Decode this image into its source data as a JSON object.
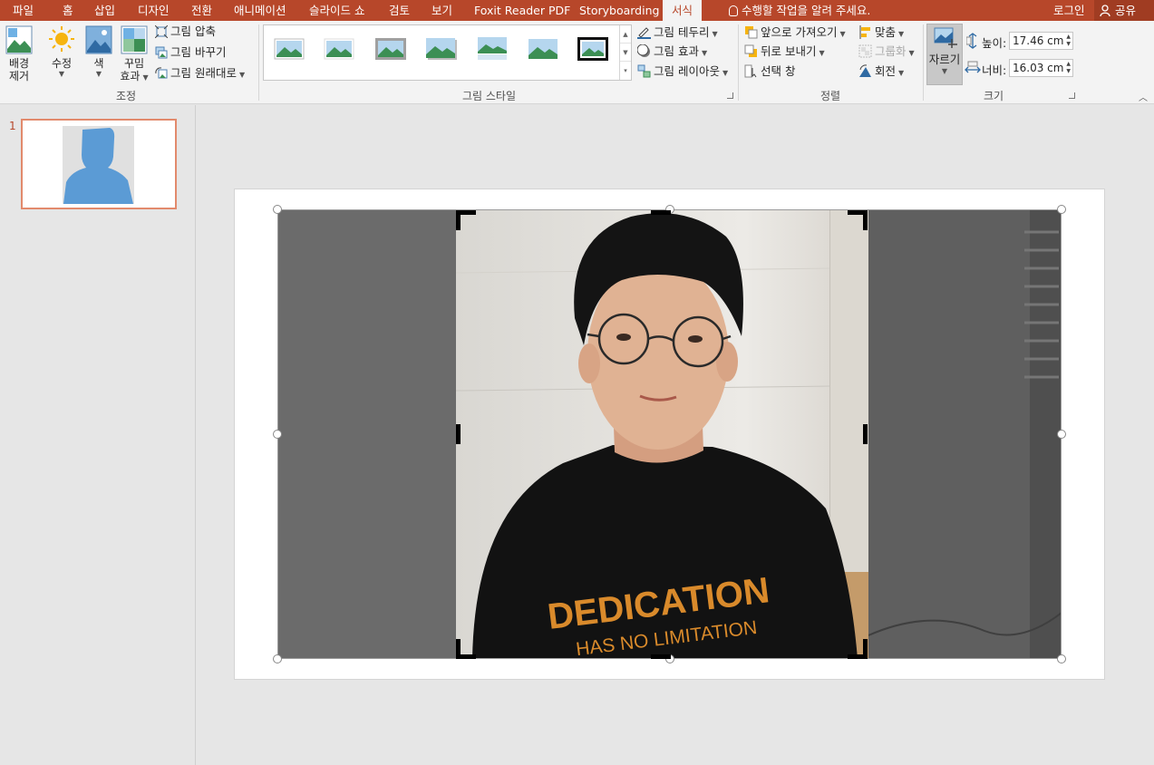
{
  "tabs": [
    "파일",
    "홈",
    "삽입",
    "디자인",
    "전환",
    "애니메이션",
    "슬라이드 쇼",
    "검토",
    "보기",
    "Foxit Reader PDF",
    "Storyboarding",
    "서식"
  ],
  "tell_me": "수행할 작업을 알려 주세요.",
  "account": {
    "login": "로그인",
    "share": "공유"
  },
  "adjust": {
    "remove_bg_line1": "배경",
    "remove_bg_line2": "제거",
    "corrections": "수정",
    "color": "색",
    "artistic_line1": "꾸밈",
    "artistic_line2": "효과",
    "compress": "그림 압축",
    "change": "그림 바꾸기",
    "reset": "그림 원래대로",
    "label": "조정"
  },
  "styles": {
    "label": "그림 스타일",
    "border": "그림 테두리",
    "effects": "그림 효과",
    "layout": "그림 레이아웃"
  },
  "arrange": {
    "label": "정렬",
    "bring_forward": "앞으로 가져오기",
    "send_backward": "뒤로 보내기",
    "selection_pane": "선택 창",
    "align": "맞춤",
    "group": "그룹화",
    "rotate": "회전"
  },
  "size": {
    "label": "크기",
    "crop": "자르기",
    "height_label": "높이:",
    "height_value": "17.46 cm",
    "width_label": "너비:",
    "width_value": "16.03 cm"
  },
  "slides_panel": {
    "slide_number": "1"
  },
  "photo": {
    "shirt_line1": "DEDICATION",
    "shirt_line2": "HAS NO LIMITATION"
  },
  "colors": {
    "accent": "#b7472a",
    "ribbon": "#f3f3f3",
    "workspace": "#e6e6e6",
    "thumb_border": "#e28a6c"
  }
}
